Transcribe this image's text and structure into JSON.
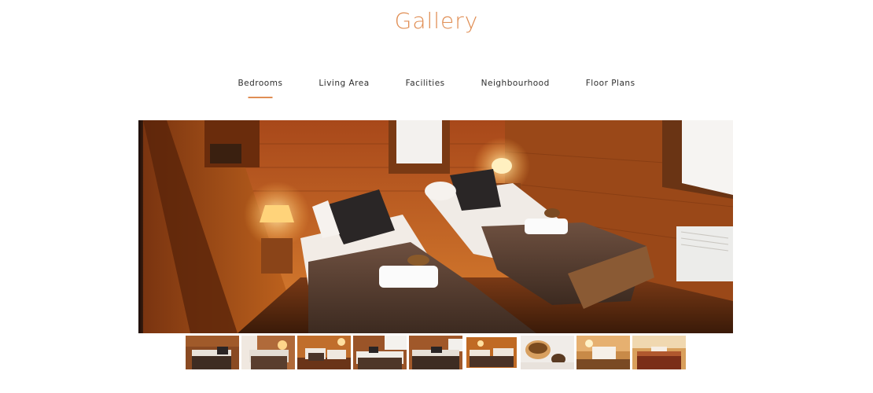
{
  "header": {
    "title": "Gallery"
  },
  "tabs": [
    {
      "label": "Bedrooms",
      "active": true
    },
    {
      "label": "Living Area",
      "active": false
    },
    {
      "label": "Facilities",
      "active": false
    },
    {
      "label": "Neighbourhood",
      "active": false
    },
    {
      "label": "Floor Plans",
      "active": false
    }
  ],
  "gallery": {
    "selected_index": 0,
    "thumbnail_count": 9
  },
  "colors": {
    "accent": "#e08e54",
    "text": "#2e2e2e"
  }
}
